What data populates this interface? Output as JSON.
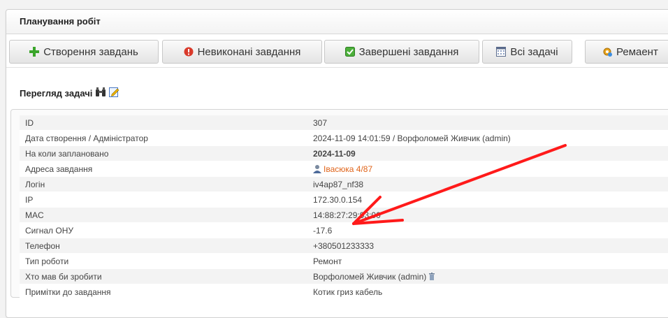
{
  "panel": {
    "title": "Планування робіт"
  },
  "toolbar": {
    "create_label": "Створення завдань",
    "pending_label": "Невиконані завдання",
    "done_label": "Завершені завдання",
    "all_label": "Всі задачі",
    "remnant_label": "Ремаент"
  },
  "view": {
    "title": "Перегляд задачі"
  },
  "details": {
    "id": {
      "label": "ID",
      "value": "307"
    },
    "created": {
      "label": "Дата створення / Адміністратор",
      "value": "2024-11-09 14:01:59 / Ворфоломей Живчик (admin)"
    },
    "planned": {
      "label": "На коли заплановано",
      "value": "2024-11-09"
    },
    "address": {
      "label": "Адреса завдання",
      "value": "Івасюка 4/87"
    },
    "login": {
      "label": "Логін",
      "value": "iv4ap87_nf38"
    },
    "ip": {
      "label": "IP",
      "value": "172.30.0.154"
    },
    "mac": {
      "label": "MAC",
      "value": "14:88:27:29:93:00"
    },
    "onu": {
      "label": "Сигнал ОНУ",
      "value": "-17.6"
    },
    "phone": {
      "label": "Телефон",
      "value": "+380501233333"
    },
    "worktype": {
      "label": "Тип роботи",
      "value": "Ремонт"
    },
    "who": {
      "label": "Хто мав би зробити",
      "value": "Ворфоломей Живчик (admin)"
    },
    "notes": {
      "label": "Примітки до завдання",
      "value": "Котик гриз кабель"
    }
  },
  "colors": {
    "accent_orange": "#e0641a",
    "signal_green": "#2a7a12",
    "annotation_red": "#ff1a1a"
  },
  "icons": [
    "plus-icon",
    "error-icon",
    "check-icon",
    "calendar-icon",
    "gear-icon",
    "binoculars-icon",
    "edit-icon",
    "user-icon",
    "trash-icon"
  ]
}
